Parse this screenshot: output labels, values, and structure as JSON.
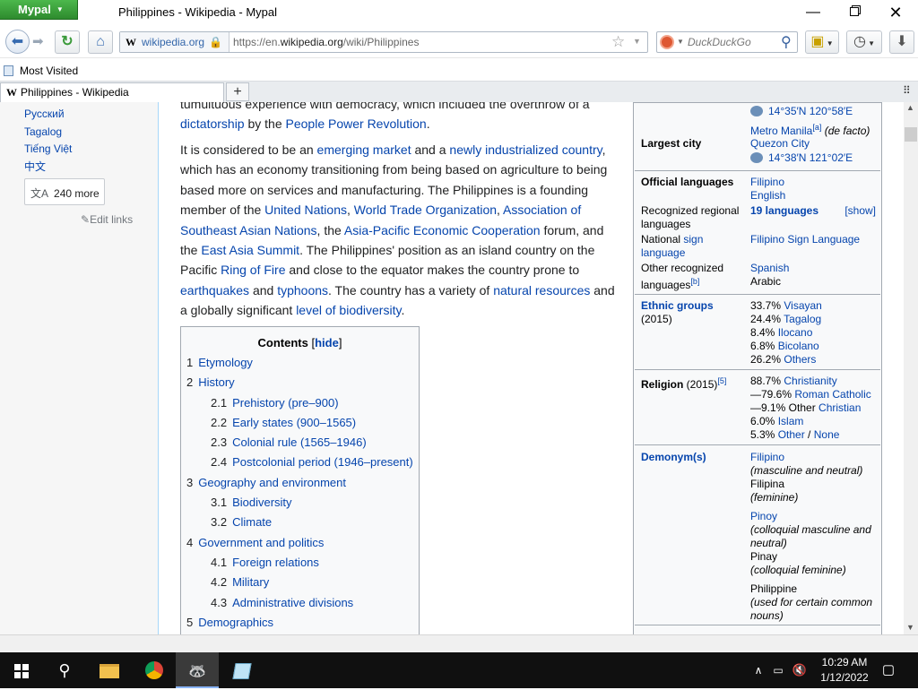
{
  "browser": {
    "app_button": "Mypal",
    "window_title": "Philippines - Wikipedia - Mypal",
    "site_identity": "wikipedia.org",
    "url_prefix": "https://en.",
    "url_domain": "wikipedia.org",
    "url_path": "/wiki/Philippines",
    "search_placeholder": "DuckDuckGo",
    "bookmark": "Most Visited",
    "tab_title": "Philippines - Wikipedia",
    "new_tab": "+"
  },
  "sidebar": {
    "languages": [
      "Русский",
      "Tagalog",
      "Tiếng Việt",
      "中文"
    ],
    "more_label": "240 more",
    "edit_links": "Edit links"
  },
  "article": {
    "para0_l1": "tumultuous experience with democracy, which included the overthrow of a",
    "para0_link1": "dictatorship",
    "para0_mid": " by the ",
    "para0_link2": "People Power Revolution",
    "para0_end": ".",
    "p1": {
      "t1": "It is considered to be an ",
      "l1": "emerging market",
      "t2": " and a ",
      "l2": "newly industrialized country",
      "t3": ", which has an economy transitioning from being based on agriculture to being based more on services and manufacturing. The Philippines is a founding member of the ",
      "l3": "United Nations",
      "t4": ", ",
      "l4": "World Trade Organization",
      "t5": ", ",
      "l5": "Association of Southeast Asian Nations",
      "t6": ", the ",
      "l6": "Asia-Pacific Economic Cooperation",
      "t7": " forum, and the ",
      "l7": "East Asia Summit",
      "t8": ". The Philippines' position as an island country on the Pacific ",
      "l8": "Ring of Fire",
      "t9": " and close to the equator makes the country prone to ",
      "l9": "earthquakes",
      "t10": " and ",
      "l10": "typhoons",
      "t11": ". The country has a variety of ",
      "l11": "natural resources",
      "t12": " and a globally significant ",
      "l12": "level of biodiversity",
      "t13": "."
    }
  },
  "toc": {
    "title": "Contents",
    "hide": "hide",
    "items": [
      {
        "num": "1",
        "label": "Etymology",
        "level": 1
      },
      {
        "num": "2",
        "label": "History",
        "level": 1
      },
      {
        "num": "2.1",
        "label": "Prehistory (pre–900)",
        "level": 2
      },
      {
        "num": "2.2",
        "label": "Early states (900–1565)",
        "level": 2
      },
      {
        "num": "2.3",
        "label": "Colonial rule (1565–1946)",
        "level": 2
      },
      {
        "num": "2.4",
        "label": "Postcolonial period (1946–present)",
        "level": 2
      },
      {
        "num": "3",
        "label": "Geography and environment",
        "level": 1
      },
      {
        "num": "3.1",
        "label": "Biodiversity",
        "level": 2
      },
      {
        "num": "3.2",
        "label": "Climate",
        "level": 2
      },
      {
        "num": "4",
        "label": "Government and politics",
        "level": 1
      },
      {
        "num": "4.1",
        "label": "Foreign relations",
        "level": 2
      },
      {
        "num": "4.2",
        "label": "Military",
        "level": 2
      },
      {
        "num": "4.3",
        "label": "Administrative divisions",
        "level": 2
      },
      {
        "num": "5",
        "label": "Demographics",
        "level": 1
      }
    ]
  },
  "infobox": {
    "coord1": "14°35′N 120°58′E",
    "metro": "Metro Manila",
    "metro_sup": "[a]",
    "de_facto": "(de facto)",
    "largest_city_label": "Largest city",
    "largest_city": "Quezon City",
    "coord2": "14°38′N 121°02′E",
    "official_lang_label": "Official languages",
    "official_langs": [
      "Filipino",
      "English"
    ],
    "recognized_label": "Recognized regional languages",
    "recognized_value": "19 languages",
    "show": "[show]",
    "national_sign_label_pre": "National ",
    "national_sign_link": "sign language",
    "national_sign_value": "Filipino Sign Language",
    "other_label": "Other recognized languages",
    "other_sup": "[b]",
    "other_values": [
      "Spanish",
      "Arabic"
    ],
    "ethnic_label": "Ethnic groups",
    "ethnic_year": "(2015)",
    "ethnic": [
      {
        "pct": "33.7%",
        "name": "Visayan"
      },
      {
        "pct": "24.4%",
        "name": "Tagalog"
      },
      {
        "pct": "8.4%",
        "name": "Ilocano"
      },
      {
        "pct": "6.8%",
        "name": "Bicolano"
      },
      {
        "pct": "26.2%",
        "name": "Others"
      }
    ],
    "religion_label": "Religion",
    "religion_year": " (2015)",
    "religion_sup": "[5]",
    "religion": {
      "r1_pct": "88.7%",
      "r1": "Christianity",
      "r2_pct": "—79.6%",
      "r2": "Roman Catholic",
      "r3_pct": "—9.1% Other",
      "r3": "Christian",
      "r4_pct": "6.0%",
      "r4": "Islam",
      "r5_pct": "5.3%",
      "r5a": "Other",
      "r5sep": " / ",
      "r5b": "None"
    },
    "demonym_label": "Demonym(s)",
    "demonyms": {
      "d1": "Filipino",
      "d1n": "(masculine and neutral)",
      "d2": "Filipina",
      "d2n": "(feminine)",
      "d3": "Pinoy",
      "d3n": "(colloquial masculine and neutral)",
      "d4": "Pinay",
      "d4n": "(colloquial feminine)",
      "d5": "Philippine",
      "d5n": "(used for certain common nouns)"
    }
  },
  "taskbar": {
    "time": "10:29 AM",
    "date": "1/12/2022"
  }
}
